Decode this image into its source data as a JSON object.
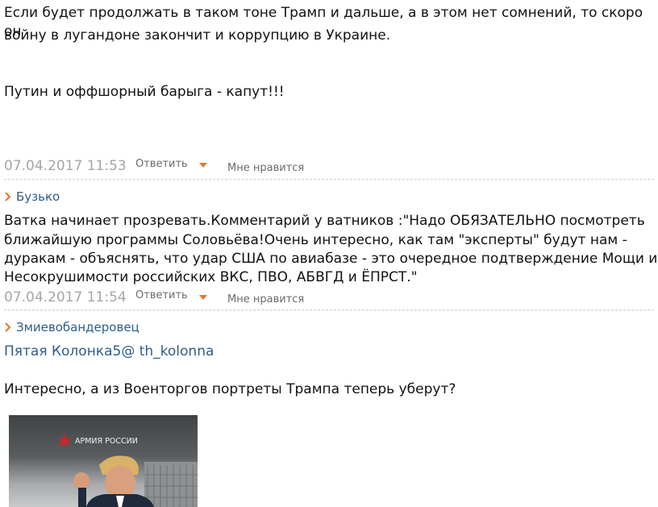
{
  "comment1": {
    "text_line1": "Если будет продолжать в таком тоне Трамп и дальше, а в этом нет сомнений, то скоро он",
    "text_line2": "войну в лугандоне закончит и коррупцию в Украине.",
    "text_line3": "Путин и оффшорный барыга - капут!!!",
    "date": "07.04.2017 11:53",
    "reply_label": "Ответить",
    "like_label": "Мне нравится"
  },
  "comment2": {
    "author": "Бузько",
    "text_line1": "Ватка начинает прозревать.Комментарий у ватников :\"Надо ОБЯЗАТЕЛЬНО посмотреть",
    "text_line2": "ближайшую программы Соловьёва!Очень интересно, как там \"эксперты\" будут нам -",
    "text_line3": "дуракам - объяснять, что удар США по авиабазе - это очередное подтверждение Мощи и",
    "text_line4": "Несокрушимости российских ВКС, ПВО, АБВГД и ЁПРСТ.\"",
    "date": "07.04.2017 11:54",
    "reply_label": "Ответить",
    "like_label": "Мне нравится"
  },
  "comment3": {
    "author": "Змиевобандеровец",
    "link_text": "Пятая Колонка5@ th_kolonna",
    "text_line1": "Интересно, а из Военторгов портреты Трампа теперь уберут?",
    "image_banner": "АРМИЯ РОССИИ"
  },
  "colors": {
    "accent_orange": "#e8742c",
    "link_blue": "#2e5d8c",
    "date_gray": "#a6a6a6"
  }
}
